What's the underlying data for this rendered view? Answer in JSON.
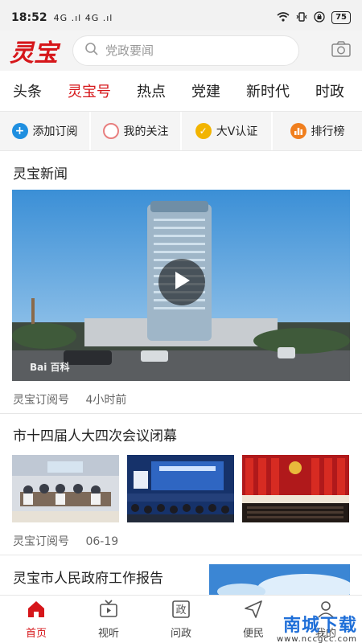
{
  "status_bar": {
    "time": "18:52",
    "signal": "4G .ıl 4G .ıl",
    "battery": "75"
  },
  "header": {
    "logo": "灵宝",
    "search_placeholder": "党政要闻"
  },
  "tabs": [
    "头条",
    "灵宝号",
    "热点",
    "党建",
    "新时代",
    "时政"
  ],
  "quick_actions": [
    {
      "label": "添加订阅",
      "icon": "plus-icon",
      "color": "#1f8fe0"
    },
    {
      "label": "我的关注",
      "icon": "circle-icon",
      "color": "#e87f7f"
    },
    {
      "label": "大V认证",
      "icon": "check-icon",
      "color": "#f2b400"
    },
    {
      "label": "排行榜",
      "icon": "ranking-icon",
      "color": "#f07f1e"
    }
  ],
  "feed": {
    "section1": {
      "title": "灵宝新闻",
      "source": "灵宝订阅号",
      "time": "4小时前",
      "image_text": "Bai 百科"
    },
    "article2": {
      "title": "市十四届人大四次会议闭幕",
      "source": "灵宝订阅号",
      "time": "06-19"
    },
    "article3": {
      "title": "灵宝市人民政府工作报告"
    }
  },
  "bottom_nav": [
    {
      "label": "首页",
      "icon": "home-icon",
      "active": true
    },
    {
      "label": "视听",
      "icon": "tv-icon",
      "active": false
    },
    {
      "label": "问政",
      "icon": "politics-icon",
      "active": false
    },
    {
      "label": "便民",
      "icon": "send-icon",
      "active": false
    },
    {
      "label": "我的",
      "icon": "user-icon",
      "active": false
    }
  ],
  "watermark": {
    "main": "南城下载",
    "sub": "www.nccgcc.com"
  },
  "colors": {
    "accent": "#d6161a",
    "background": "#ffffff"
  }
}
